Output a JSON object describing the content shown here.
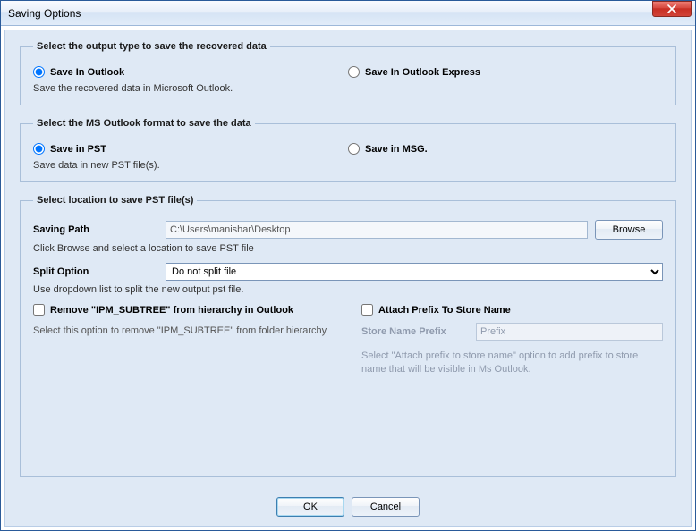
{
  "window": {
    "title": "Saving Options"
  },
  "group1": {
    "legend": "Select the output type to save the recovered data",
    "opt1": "Save In Outlook",
    "opt2": "Save In Outlook Express",
    "desc": "Save the recovered data in Microsoft Outlook."
  },
  "group2": {
    "legend": "Select the MS Outlook format to save the data",
    "opt1": "Save in PST",
    "opt2": "Save in MSG.",
    "desc": "Save data in new PST file(s)."
  },
  "group3": {
    "legend": "Select location to save PST file(s)",
    "pathLabel": "Saving Path",
    "pathValue": "C:\\Users\\manishar\\Desktop",
    "browse": "Browse",
    "browseHint": "Click Browse and select a location to save PST file",
    "splitLabel": "Split Option",
    "splitValue": "Do not split file",
    "splitHint": "Use dropdown list to split the new output pst file.",
    "removeCheck": "Remove \"IPM_SUBTREE\" from hierarchy in Outlook",
    "removeDesc": "Select this option to remove \"IPM_SUBTREE\" from folder hierarchy",
    "attachCheck": "Attach Prefix To Store Name",
    "storeLabel": "Store Name Prefix",
    "storePlaceholder": "Prefix",
    "storeDesc": "Select \"Attach prefix to store name\" option to add prefix to store name that will be visible in Ms Outlook."
  },
  "buttons": {
    "ok": "OK",
    "cancel": "Cancel"
  }
}
